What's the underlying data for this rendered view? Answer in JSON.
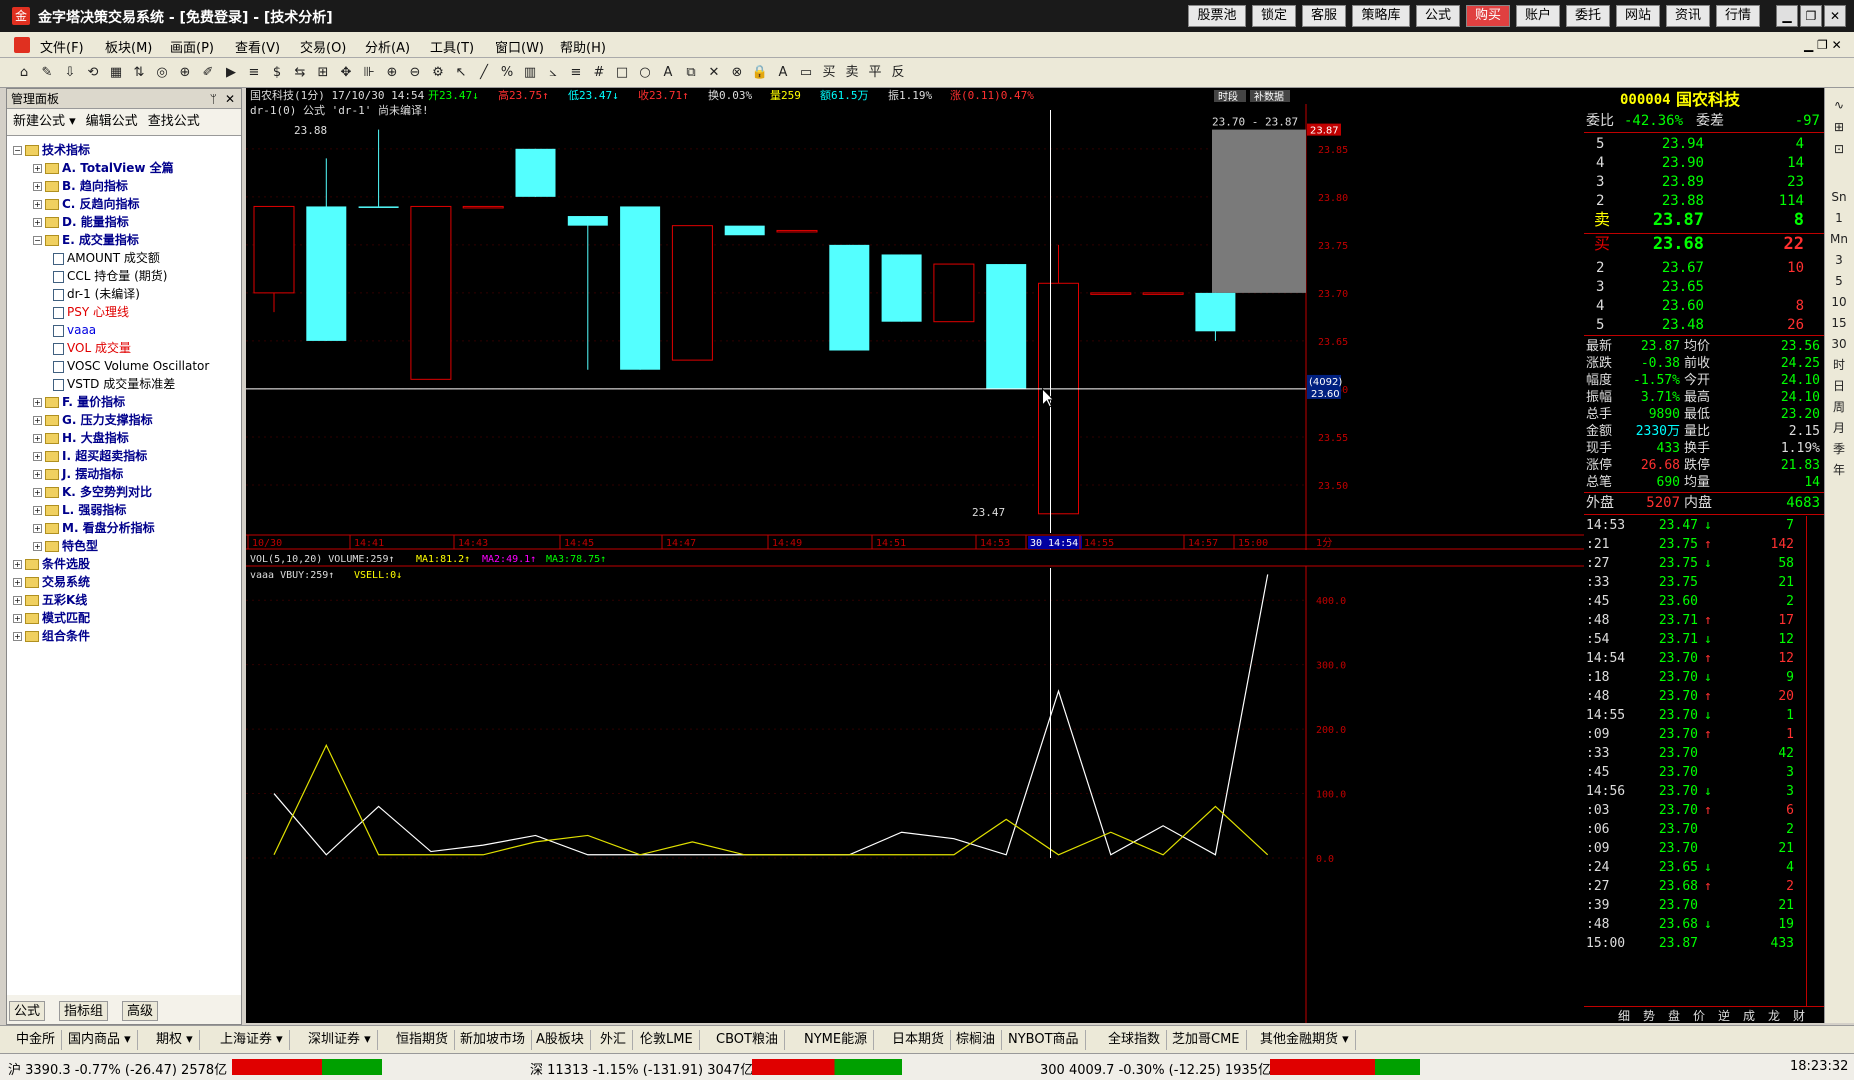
{
  "titlebar": {
    "title": "金字塔决策交易系统 - [免费登录] - [技术分析]",
    "buttons": [
      "股票池",
      "锁定",
      "客服",
      "策略库",
      "公式",
      "购买",
      "账户",
      "委托",
      "网站",
      "资讯",
      "行情"
    ]
  },
  "menu": [
    "文件(F)",
    "板块(M)",
    "画面(P)",
    "查看(V)",
    "交易(O)",
    "分析(A)",
    "工具(T)",
    "窗口(W)",
    "帮助(H)"
  ],
  "leftpanel": {
    "title": "管理面板",
    "actions": [
      "新建公式 ▾",
      "编辑公式",
      "查找公式"
    ],
    "tree": [
      {
        "t": "技术指标",
        "d": 0,
        "k": "f",
        "b": 1
      },
      {
        "t": "A. TotalView 全篇",
        "d": 1,
        "k": "f",
        "b": 1
      },
      {
        "t": "B. 趋向指标",
        "d": 1,
        "k": "f",
        "b": 1
      },
      {
        "t": "C. 反趋向指标",
        "d": 1,
        "k": "f",
        "b": 1
      },
      {
        "t": "D. 能量指标",
        "d": 1,
        "k": "f",
        "b": 1
      },
      {
        "t": "E. 成交量指标",
        "d": 1,
        "k": "f",
        "b": 1
      },
      {
        "t": "AMOUNT 成交额",
        "d": 2,
        "k": "d"
      },
      {
        "t": "CCL 持仓量 (期货)",
        "d": 2,
        "k": "d"
      },
      {
        "t": "dr-1 (未编译)",
        "d": 2,
        "k": "d"
      },
      {
        "t": "PSY 心理线",
        "d": 2,
        "k": "d",
        "c": "red"
      },
      {
        "t": "vaaa",
        "d": 2,
        "k": "d",
        "c": "blue"
      },
      {
        "t": "VOL 成交量",
        "d": 2,
        "k": "d",
        "c": "red"
      },
      {
        "t": "VOSC Volume Oscillator",
        "d": 2,
        "k": "d"
      },
      {
        "t": "VSTD 成交量标准差",
        "d": 2,
        "k": "d"
      },
      {
        "t": "F. 量价指标",
        "d": 1,
        "k": "f",
        "b": 1
      },
      {
        "t": "G. 压力支撑指标",
        "d": 1,
        "k": "f",
        "b": 1
      },
      {
        "t": "H. 大盘指标",
        "d": 1,
        "k": "f",
        "b": 1
      },
      {
        "t": "I. 超买超卖指标",
        "d": 1,
        "k": "f",
        "b": 1
      },
      {
        "t": "J. 摆动指标",
        "d": 1,
        "k": "f",
        "b": 1
      },
      {
        "t": "K. 多空势判对比",
        "d": 1,
        "k": "f",
        "b": 1
      },
      {
        "t": "L. 强弱指标",
        "d": 1,
        "k": "f",
        "b": 1
      },
      {
        "t": "M. 看盘分析指标",
        "d": 1,
        "k": "f",
        "b": 1
      },
      {
        "t": "特色型",
        "d": 1,
        "k": "f",
        "b": 1
      },
      {
        "t": "条件选股",
        "d": 0,
        "k": "f",
        "b": 1
      },
      {
        "t": "交易系统",
        "d": 0,
        "k": "f",
        "b": 1
      },
      {
        "t": "五彩K线",
        "d": 0,
        "k": "f",
        "b": 1
      },
      {
        "t": "模式匹配",
        "d": 0,
        "k": "f",
        "b": 1
      },
      {
        "t": "组合条件",
        "d": 0,
        "k": "f",
        "b": 1
      }
    ],
    "tabs": [
      "公式",
      "指标组",
      "高级"
    ]
  },
  "chart": {
    "header": "国农科技(1分) 17/10/30 14:54",
    "hdr_open": "开23.47↓",
    "hdr_high": "高23.75↑",
    "hdr_low": "低23.47↓",
    "hdr_close": "收23.71↑",
    "hdr_chg": "换0.03%",
    "hdr_vol": "量259",
    "hdr_amt": "额61.5万",
    "hdr_amp": "振1.19%",
    "hdr_rise": "涨(0.11)0.47%",
    "formula_line": "dr-1(0)   公式 'dr-1' 尚未编译!",
    "btn_time": "时段",
    "btn_data": "补数据",
    "label_high": "23.88",
    "label_low": "23.47",
    "range_label": "23.70 - 23.87",
    "yticks": [
      "23.85",
      "23.80",
      "23.75",
      "23.70",
      "23.65",
      "23.60",
      "23.55",
      "23.50"
    ],
    "price_tag": "23.87",
    "cursor_tag1": "(4092)",
    "cursor_tag2": "23.60",
    "xticks": [
      "10/30",
      "14:41",
      "14:43",
      "14:45",
      "14:47",
      "14:49",
      "14:51",
      "14:53",
      "30 14:54",
      "14:55",
      "14:57",
      "15:00"
    ],
    "period": "1分",
    "vol_line": "VOL(5,10,20)  VOLUME:259↑",
    "vol_ma1": "MA1:81.2↑",
    "vol_ma2": "MA2:49.1↑",
    "vol_ma3": "MA3:78.75↑",
    "vaaa_line": "vaaa  VBUY:259↑",
    "vaaa_sell": "VSELL:0↓",
    "lower_yticks": [
      "400.0",
      "300.0",
      "200.0",
      "100.0",
      "0.0"
    ]
  },
  "chart_data": {
    "type": "candlestick",
    "ylim": [
      23.45,
      23.88
    ],
    "candles": [
      {
        "o": 23.7,
        "h": 23.79,
        "l": 23.68,
        "c": 23.79,
        "up": 1
      },
      {
        "o": 23.79,
        "h": 23.84,
        "l": 23.65,
        "c": 23.65,
        "up": 0
      },
      {
        "o": 23.79,
        "h": 23.87,
        "l": 23.79,
        "c": 23.79,
        "up": 0
      },
      {
        "o": 23.61,
        "h": 23.79,
        "l": 23.61,
        "c": 23.79,
        "up": 1
      },
      {
        "o": 23.79,
        "h": 23.79,
        "l": 23.79,
        "c": 23.79,
        "up": 1
      },
      {
        "o": 23.8,
        "h": 23.85,
        "l": 23.8,
        "c": 23.85,
        "up": 0
      },
      {
        "o": 23.78,
        "h": 23.78,
        "l": 23.62,
        "c": 23.77,
        "up": 0
      },
      {
        "o": 23.79,
        "h": 23.79,
        "l": 23.62,
        "c": 23.62,
        "up": 0
      },
      {
        "o": 23.63,
        "h": 23.77,
        "l": 23.63,
        "c": 23.77,
        "up": 1
      },
      {
        "o": 23.77,
        "h": 23.77,
        "l": 23.77,
        "c": 23.76,
        "up": 0
      },
      {
        "o": 23.765,
        "h": 23.765,
        "l": 23.765,
        "c": 23.765,
        "up": 1
      },
      {
        "o": 23.75,
        "h": 23.75,
        "l": 23.64,
        "c": 23.64,
        "up": 0
      },
      {
        "o": 23.74,
        "h": 23.74,
        "l": 23.67,
        "c": 23.67,
        "up": 0
      },
      {
        "o": 23.67,
        "h": 23.73,
        "l": 23.67,
        "c": 23.73,
        "up": 1
      },
      {
        "o": 23.73,
        "h": 23.73,
        "l": 23.6,
        "c": 23.6,
        "up": 0
      },
      {
        "o": 23.47,
        "h": 23.75,
        "l": 23.47,
        "c": 23.71,
        "up": 1
      },
      {
        "o": 23.7,
        "h": 23.7,
        "l": 23.7,
        "c": 23.7,
        "up": 1
      },
      {
        "o": 23.7,
        "h": 23.7,
        "l": 23.7,
        "c": 23.7,
        "up": 1
      },
      {
        "o": 23.7,
        "h": 23.7,
        "l": 23.65,
        "c": 23.66,
        "up": 0
      }
    ],
    "vbuy": [
      100,
      5,
      80,
      10,
      20,
      35,
      5,
      5,
      5,
      5,
      5,
      5,
      40,
      30,
      5,
      259,
      5,
      50,
      5,
      440
    ],
    "vsell": [
      5,
      175,
      5,
      5,
      5,
      25,
      35,
      5,
      25,
      5,
      5,
      5,
      5,
      5,
      60,
      5,
      40,
      5,
      80,
      5
    ]
  },
  "quote": {
    "code": "000004",
    "name": "国农科技",
    "wb_label": "委比",
    "wb": "-42.36%",
    "wc_label": "委差",
    "wc": "-97",
    "asks": [
      [
        "5",
        "23.94",
        "4"
      ],
      [
        "4",
        "23.90",
        "14"
      ],
      [
        "3",
        "23.89",
        "23"
      ],
      [
        "2",
        "23.88",
        "114"
      ]
    ],
    "ask1": [
      "卖",
      "23.87",
      "8"
    ],
    "bid1": [
      "买",
      "23.68",
      "22"
    ],
    "bids": [
      [
        "2",
        "23.67",
        "10"
      ],
      [
        "3",
        "23.65",
        ""
      ],
      [
        "4",
        "23.60",
        "8"
      ],
      [
        "5",
        "23.48",
        "26"
      ]
    ],
    "stats": [
      [
        "最新",
        "23.87",
        "均价",
        "23.56"
      ],
      [
        "涨跌",
        "-0.38",
        "前收",
        "24.25"
      ],
      [
        "幅度",
        "-1.57%",
        "今开",
        "24.10"
      ],
      [
        "振幅",
        "3.71%",
        "最高",
        "24.10"
      ],
      [
        "总手",
        "9890",
        "最低",
        "23.20"
      ],
      [
        "金额",
        "2330万",
        "量比",
        "2.15"
      ],
      [
        "现手",
        "433",
        "换手",
        "1.19%"
      ],
      [
        "涨停",
        "26.68",
        "跌停",
        "21.83"
      ],
      [
        "总笔",
        "690",
        "均量",
        "14"
      ]
    ],
    "outer_label": "外盘",
    "outer": "5207",
    "inner_label": "内盘",
    "inner": "4683",
    "ticks": [
      [
        "14:53",
        "23.47",
        "↓",
        "7"
      ],
      [
        ":21",
        "23.75",
        "↑",
        "142"
      ],
      [
        ":27",
        "23.75",
        "↓",
        "58"
      ],
      [
        ":33",
        "23.75",
        "",
        "21"
      ],
      [
        ":45",
        "23.60",
        "",
        "2"
      ],
      [
        ":48",
        "23.71",
        "↑",
        "17"
      ],
      [
        ":54",
        "23.71",
        "↓",
        "12"
      ],
      [
        "14:54",
        "23.70",
        "↑",
        "12"
      ],
      [
        ":18",
        "23.70",
        "↓",
        "9"
      ],
      [
        ":48",
        "23.70",
        "↑",
        "20"
      ],
      [
        "14:55",
        "23.70",
        "↓",
        "1"
      ],
      [
        ":09",
        "23.70",
        "↑",
        "1"
      ],
      [
        ":33",
        "23.70",
        "",
        "42"
      ],
      [
        ":45",
        "23.70",
        "",
        "3"
      ],
      [
        "14:56",
        "23.70",
        "↓",
        "3"
      ],
      [
        ":03",
        "23.70",
        "↑",
        "6"
      ],
      [
        ":06",
        "23.70",
        "",
        "2"
      ],
      [
        ":09",
        "23.70",
        "",
        "21"
      ],
      [
        ":24",
        "23.65",
        "↓",
        "4"
      ],
      [
        ":27",
        "23.68",
        "↑",
        "2"
      ],
      [
        ":39",
        "23.70",
        "",
        "21"
      ],
      [
        ":48",
        "23.68",
        "↓",
        "19"
      ],
      [
        "15:00",
        "23.87",
        "",
        "433"
      ]
    ],
    "tabs": [
      "细",
      "势",
      "盘",
      "价",
      "逆",
      "成",
      "龙",
      "财"
    ]
  },
  "rightstrip": [
    "Sn",
    "1",
    "Mn",
    "3",
    "5",
    "10",
    "15",
    "30",
    "时",
    "日",
    "周",
    "月",
    "季",
    "年"
  ],
  "bottombar": [
    "中金所",
    "国内商品 ▾",
    "期权 ▾",
    "上海证券 ▾",
    "深圳证券 ▾",
    "恒指期货",
    "新加坡市场",
    "A股板块",
    "外汇",
    "伦敦LME",
    "CBOT粮油",
    "NYME能源",
    "日本期货",
    "棕榈油",
    "NYBOT商品",
    "全球指数",
    "芝加哥CME",
    "其他金融期货 ▾"
  ],
  "status": {
    "sh": "沪 3390.3 -0.77% (-26.47) 2578亿",
    "sz": "深 11313 -1.15% (-131.91) 3047亿",
    "hs": "300 4009.7 -0.30% (-12.25) 1935亿",
    "time": "18:23:32"
  }
}
